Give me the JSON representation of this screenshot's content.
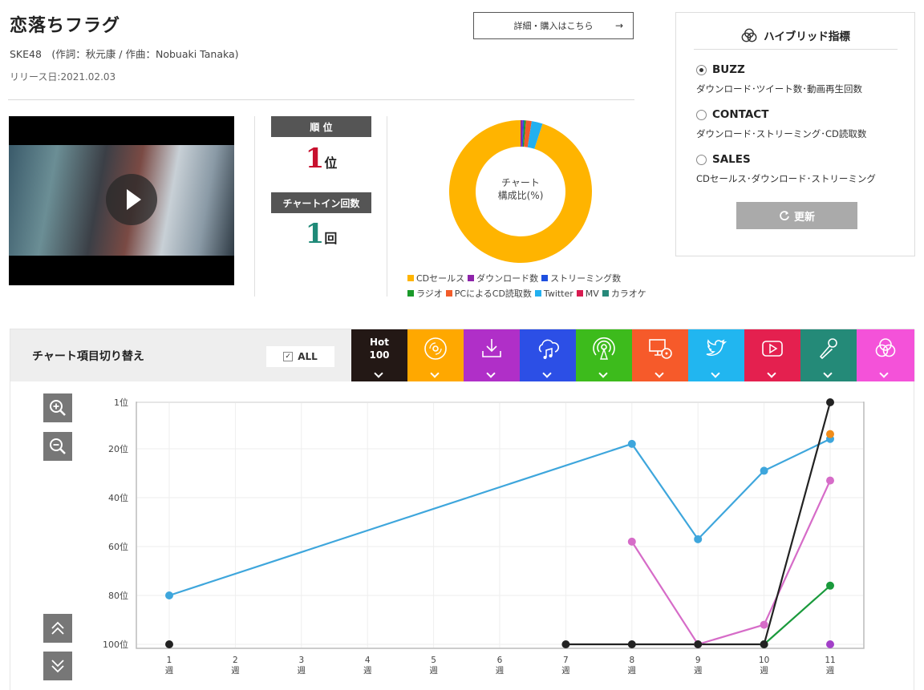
{
  "song": {
    "title": "恋落ちフラグ",
    "credits": "SKE48　(作詞：秋元康 / 作曲：Nobuaki Tanaka)",
    "release": "リリース日:2021.02.03",
    "detail_button": "詳細・購入はこちら",
    "detail_arrow": "→"
  },
  "stats": {
    "rank_label": "順 位",
    "rank_value": "1",
    "rank_unit": "位",
    "chartin_label": "チャートイン回数",
    "chartin_value": "1",
    "chartin_unit": "回"
  },
  "donut": {
    "center_line1": "チャート",
    "center_line2": "構成比(%)",
    "segments": [
      {
        "name": "CDセールス",
        "value": 95.0,
        "color": "#ffb400"
      },
      {
        "name": "ダウンロード数",
        "value": 0.5,
        "color": "#8e24aa"
      },
      {
        "name": "ストリーミング数",
        "value": 0.3,
        "color": "#1e4fe0"
      },
      {
        "name": "ラジオ",
        "value": 0.4,
        "color": "#1a9a2a"
      },
      {
        "name": "PCによるCD読取数",
        "value": 1.3,
        "color": "#f25c2a"
      },
      {
        "name": "Twitter",
        "value": 2.5,
        "color": "#22b0f0"
      }
    ],
    "legend": [
      {
        "label": "CDセールス",
        "color": "#ffb400"
      },
      {
        "label": "ダウンロード数",
        "color": "#8e24aa"
      },
      {
        "label": "ストリーミング数",
        "color": "#1e4fe0"
      },
      {
        "label": "ラジオ",
        "color": "#1a9a2a"
      },
      {
        "label": "PCによるCD読取数",
        "color": "#f25c2a"
      },
      {
        "label": "Twitter",
        "color": "#22b0f0"
      },
      {
        "label": "MV",
        "color": "#d81b50"
      },
      {
        "label": "カラオケ",
        "color": "#26897a"
      }
    ]
  },
  "hybrid": {
    "title": "ハイブリッド指標",
    "options": [
      {
        "label": "BUZZ",
        "desc": "ダウンロード･ツイート数･動画再生回数",
        "selected": true
      },
      {
        "label": "CONTACT",
        "desc": "ダウンロード･ストリーミング･CD読取数",
        "selected": false
      },
      {
        "label": "SALES",
        "desc": "CDセールス･ダウンロード･ストリーミング",
        "selected": false
      }
    ],
    "update_button": "更新",
    "update_icon": "refresh-icon"
  },
  "switcher": {
    "label": "チャート項目切り替え",
    "all_label": "ALL",
    "all_check": "✓",
    "hot_line1": "Hot",
    "hot_line2": "100",
    "tabs": [
      {
        "name": "hot100",
        "color": "#231815"
      },
      {
        "name": "cd-sales",
        "color": "#ffa800",
        "icon": "cd-icon"
      },
      {
        "name": "download",
        "color": "#b02fc8",
        "icon": "download-icon"
      },
      {
        "name": "streaming",
        "color": "#2c4fe6",
        "icon": "cloud-music-icon"
      },
      {
        "name": "radio",
        "color": "#3dbb1c",
        "icon": "radio-icon"
      },
      {
        "name": "pc-cd-read",
        "color": "#f65a2a",
        "icon": "pc-cd-icon"
      },
      {
        "name": "twitter",
        "color": "#21b6f0",
        "icon": "twitter-icon"
      },
      {
        "name": "mv",
        "color": "#e4204f",
        "icon": "play-icon"
      },
      {
        "name": "karaoke",
        "color": "#248a78",
        "icon": "microphone-icon"
      },
      {
        "name": "hybrid",
        "color": "#f452d9",
        "icon": "venn-icon"
      }
    ]
  },
  "chart_data": {
    "type": "line",
    "y_reversed": true,
    "ylim": [
      1,
      100
    ],
    "y_ticks": [
      "1位",
      "20位",
      "40位",
      "60位",
      "80位",
      "100位"
    ],
    "y_tick_values": [
      1,
      20,
      40,
      60,
      80,
      100
    ],
    "x": [
      1,
      2,
      3,
      4,
      5,
      6,
      7,
      8,
      9,
      10,
      11
    ],
    "x_labels_num": [
      "1",
      "2",
      "3",
      "4",
      "5",
      "6",
      "7",
      "8",
      "9",
      "10",
      "11"
    ],
    "x_label_unit": "週",
    "grid": true,
    "series": [
      {
        "color": "#3ea6dc",
        "points": [
          [
            1,
            80
          ],
          [
            8,
            18
          ],
          [
            9,
            57
          ],
          [
            10,
            29
          ],
          [
            11,
            16
          ]
        ]
      },
      {
        "color": "#d66cc8",
        "points": [
          [
            8,
            58
          ],
          [
            9,
            100
          ],
          [
            10,
            92
          ],
          [
            11,
            33
          ]
        ]
      },
      {
        "color": "#1a9a3c",
        "points": [
          [
            10,
            100
          ],
          [
            11,
            76
          ]
        ]
      },
      {
        "color": "#f08c1a",
        "points": [
          [
            11,
            14
          ]
        ]
      },
      {
        "color": "#a23fc8",
        "points": [
          [
            11,
            100
          ]
        ]
      },
      {
        "color": "#222222",
        "points": [
          [
            1,
            100
          ]
        ]
      },
      {
        "color": "#222222",
        "points": [
          [
            7,
            100
          ],
          [
            8,
            100
          ],
          [
            9,
            100
          ],
          [
            10,
            100
          ],
          [
            11,
            1
          ]
        ]
      }
    ]
  }
}
